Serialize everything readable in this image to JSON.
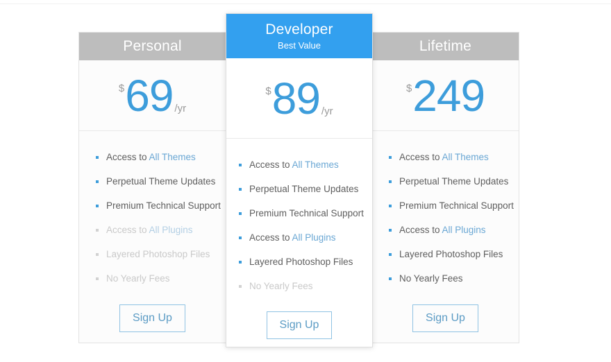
{
  "colors": {
    "featured_header": "#33a0ef",
    "default_header": "#bdbdbd",
    "price": "#3d9ddb",
    "highlight": "#6aa7d4",
    "button_border": "#8fc2e3",
    "button_text": "#5b9bc4",
    "page_background": "#ffffff"
  },
  "plans": [
    {
      "name": "Personal",
      "subtitle": "",
      "featured": false,
      "currency": "$",
      "amount": "69",
      "period": "/yr",
      "features": [
        {
          "prefix": "Access to ",
          "highlight": "All Themes",
          "enabled": true
        },
        {
          "prefix": "Perpetual Theme Updates",
          "highlight": "",
          "enabled": true
        },
        {
          "prefix": "Premium Technical Support",
          "highlight": "",
          "enabled": true
        },
        {
          "prefix": "Access to ",
          "highlight": "All Plugins",
          "enabled": false
        },
        {
          "prefix": "Layered Photoshop Files",
          "highlight": "",
          "enabled": false
        },
        {
          "prefix": "No Yearly Fees",
          "highlight": "",
          "enabled": false
        }
      ],
      "cta": "Sign Up"
    },
    {
      "name": "Developer",
      "subtitle": "Best Value",
      "featured": true,
      "currency": "$",
      "amount": "89",
      "period": "/yr",
      "features": [
        {
          "prefix": "Access to ",
          "highlight": "All Themes",
          "enabled": true
        },
        {
          "prefix": "Perpetual Theme Updates",
          "highlight": "",
          "enabled": true
        },
        {
          "prefix": "Premium Technical Support",
          "highlight": "",
          "enabled": true
        },
        {
          "prefix": "Access to ",
          "highlight": "All Plugins",
          "enabled": true
        },
        {
          "prefix": "Layered Photoshop Files",
          "highlight": "",
          "enabled": true
        },
        {
          "prefix": "No Yearly Fees",
          "highlight": "",
          "enabled": false
        }
      ],
      "cta": "Sign Up"
    },
    {
      "name": "Lifetime",
      "subtitle": "",
      "featured": false,
      "currency": "$",
      "amount": "249",
      "period": "",
      "features": [
        {
          "prefix": "Access to ",
          "highlight": "All Themes",
          "enabled": true
        },
        {
          "prefix": "Perpetual Theme Updates",
          "highlight": "",
          "enabled": true
        },
        {
          "prefix": "Premium Technical Support",
          "highlight": "",
          "enabled": true
        },
        {
          "prefix": "Access to ",
          "highlight": "All Plugins",
          "enabled": true
        },
        {
          "prefix": "Layered Photoshop Files",
          "highlight": "",
          "enabled": true
        },
        {
          "prefix": "No Yearly Fees",
          "highlight": "",
          "enabled": true
        }
      ],
      "cta": "Sign Up"
    }
  ]
}
